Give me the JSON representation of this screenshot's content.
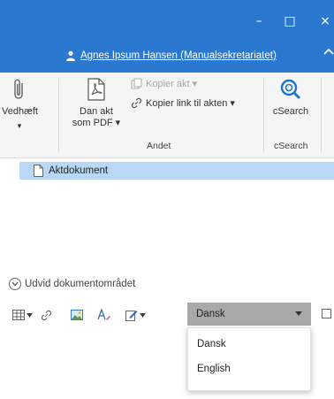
{
  "window": {
    "minimize_glyph": "–",
    "maximize_glyph": "□",
    "close_glyph": "×",
    "user": "Agnes Ipsum Hansen (Manualsekretariatet)"
  },
  "ribbon": {
    "attach_label_1": "Vedhæft",
    "attach_arrow": "▾",
    "pdf_label_1": "Dan akt",
    "pdf_label_2": "som PDF ▾",
    "copy_act": "Kopier akt ▾",
    "copy_link": "Kopier link til akten ▾",
    "group_andet": "Andet",
    "csearch_button": "cSearch",
    "group_csearch": "cSearch"
  },
  "tree": {
    "item": "Aktdokument"
  },
  "expand": {
    "label": "Udvid dokumentområdet"
  },
  "language": {
    "selected": "Dansk",
    "options": [
      "Dansk",
      "English"
    ]
  },
  "colors": {
    "titlebar": "#2b78d0",
    "selection": "#b9d8f5",
    "dropdown": "#a9a9a9"
  }
}
